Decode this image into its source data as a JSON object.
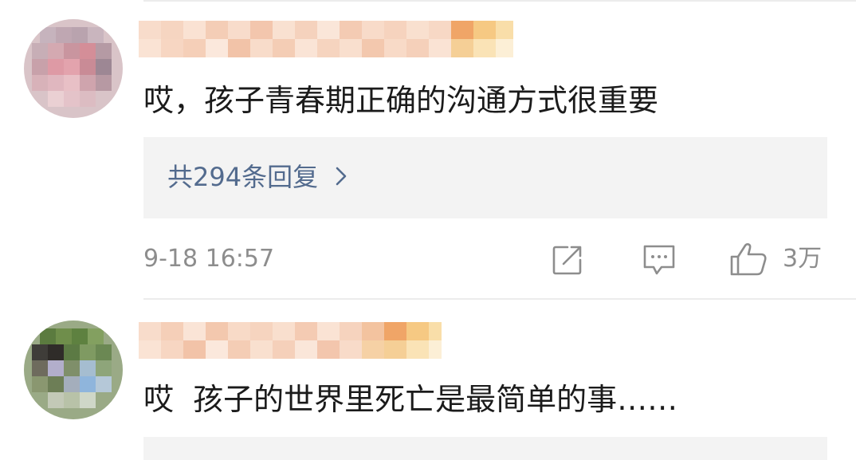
{
  "comments": [
    {
      "text": "哎，孩子青春期正确的沟通方式很重要",
      "reply_summary": "共294条回复",
      "timestamp": "9-18 16:57",
      "like_count": "3万"
    },
    {
      "text": "哎  孩子的世界里死亡是最简单的事……"
    }
  ],
  "icons": {
    "share": "share-icon",
    "comment": "comment-icon",
    "like": "thumbs-up-icon",
    "chevron": "chevron-right-icon"
  },
  "colors": {
    "link": "#536b8e",
    "meta": "#8d8d8d",
    "reply_bg": "#f3f3f3"
  }
}
